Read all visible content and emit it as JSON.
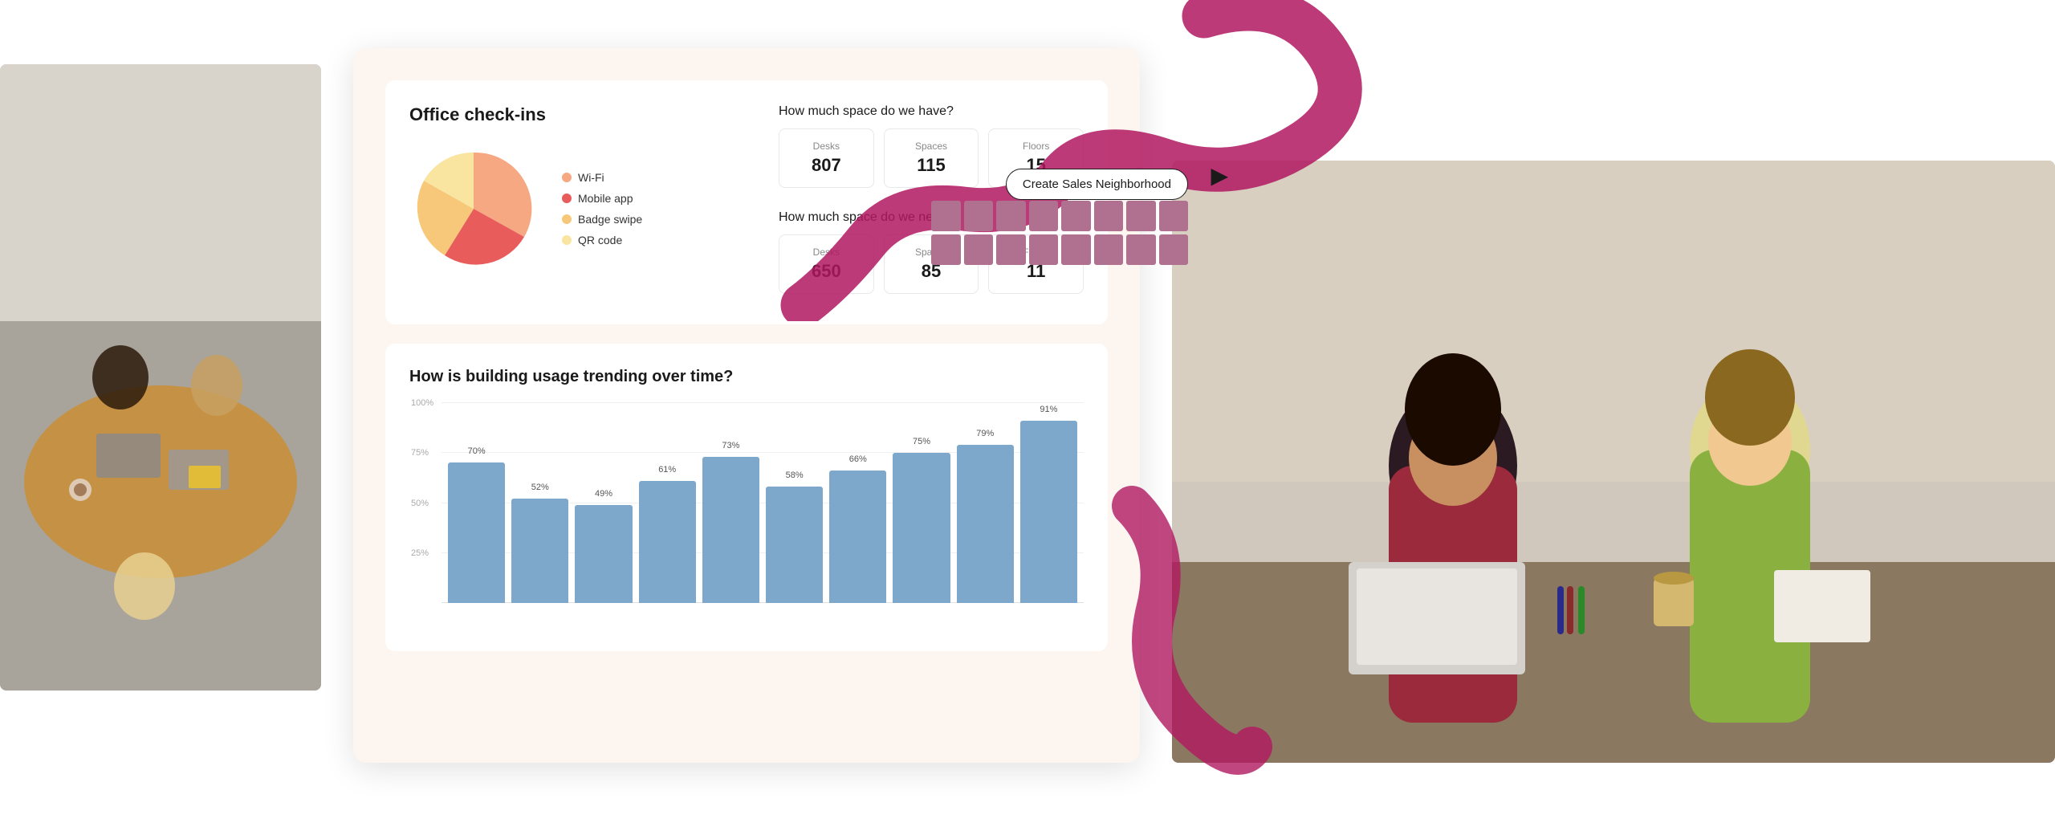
{
  "page": {
    "background": "#ffffff"
  },
  "left_photo": {
    "alt": "People working at office table from above"
  },
  "right_photo": {
    "alt": "Two women working together at a table with laptops"
  },
  "dashboard": {
    "checkins": {
      "title": "Office check-ins",
      "legend": [
        {
          "label": "Wi-Fi",
          "color": "#f5a882"
        },
        {
          "label": "Mobile app",
          "color": "#e85c5c"
        },
        {
          "label": "Badge swipe",
          "color": "#f7c87a"
        },
        {
          "label": "QR code",
          "color": "#f9e4a0"
        }
      ],
      "pie_segments": [
        {
          "label": "Wi-Fi",
          "percentage": 35,
          "color": "#f5a882"
        },
        {
          "label": "Mobile app",
          "percentage": 30,
          "color": "#e85c5c"
        },
        {
          "label": "Badge swipe",
          "percentage": 20,
          "color": "#f7c87a"
        },
        {
          "label": "QR code",
          "percentage": 15,
          "color": "#f9e4a0"
        }
      ]
    },
    "space_have": {
      "title": "How much space do we have?",
      "desks": {
        "label": "Desks",
        "value": "807"
      },
      "spaces": {
        "label": "Spaces",
        "value": "115"
      },
      "floors": {
        "label": "Floors",
        "value": "15"
      }
    },
    "space_need": {
      "title": "How much space do we need?",
      "desks": {
        "label": "Desks",
        "value": "650"
      },
      "spaces": {
        "label": "Spaces",
        "value": "85"
      },
      "floors": {
        "label": "Floors",
        "value": "11"
      }
    },
    "bar_chart": {
      "title": "How is building usage trending over time?",
      "y_labels": [
        "100%",
        "75%",
        "50%",
        "25%"
      ],
      "bars": [
        {
          "value": 70,
          "label": "70%"
        },
        {
          "value": 52,
          "label": "52%"
        },
        {
          "value": 49,
          "label": "49%"
        },
        {
          "value": 61,
          "label": "61%"
        },
        {
          "value": 73,
          "label": "73%"
        },
        {
          "value": 58,
          "label": "58%"
        },
        {
          "value": 66,
          "label": "66%"
        },
        {
          "value": 75,
          "label": "75%"
        },
        {
          "value": 79,
          "label": "79%"
        },
        {
          "value": 91,
          "label": "91%"
        }
      ]
    }
  },
  "create_button": {
    "label": "Create Sales Neighborhood"
  },
  "cursor": {
    "symbol": "▶"
  }
}
